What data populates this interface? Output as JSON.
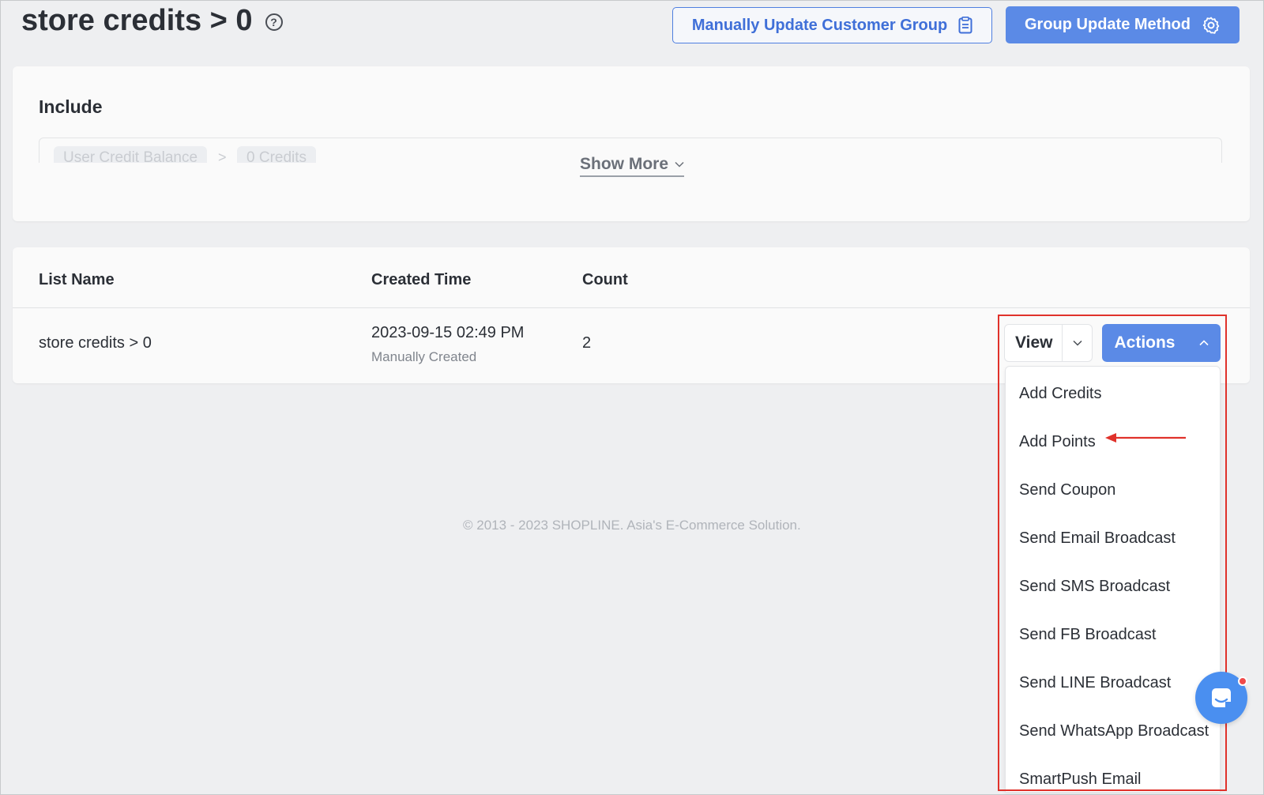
{
  "header": {
    "title": "store credits > 0",
    "help_glyph": "?",
    "manual_update_label": "Manually Update Customer Group",
    "group_update_label": "Group Update Method"
  },
  "include": {
    "title": "Include",
    "chip_field": "User Credit Balance",
    "chip_operator": ">",
    "chip_value": "0 Credits",
    "show_more": "Show More"
  },
  "table": {
    "columns": [
      "List Name",
      "Created Time",
      "Count"
    ],
    "rows": [
      {
        "name": "store credits > 0",
        "created_time": "2023-09-15 02:49 PM",
        "created_by": "Manually Created",
        "count": "2"
      }
    ]
  },
  "row_actions": {
    "view_label": "View",
    "actions_label": "Actions",
    "menu_items": [
      "Add Credits",
      "Add Points",
      "Send Coupon",
      "Send Email Broadcast",
      "Send SMS Broadcast",
      "Send FB Broadcast",
      "Send LINE Broadcast",
      "Send WhatsApp Broadcast",
      "SmartPush Email"
    ]
  },
  "footer": {
    "copyright": "© 2013 - 2023 SHOPLINE. Asia's E-Commerce Solution."
  },
  "colors": {
    "primary": "#5b8ae6",
    "annotation_red": "#e0322b",
    "background": "#eeeff1"
  },
  "icons": {
    "help": "help-circle-icon",
    "manual_update": "clipboard-list-icon",
    "group_update": "gear-icon",
    "show_more": "chevron-down-icon",
    "actions": "chevron-up-icon",
    "chat": "chat-icon"
  }
}
